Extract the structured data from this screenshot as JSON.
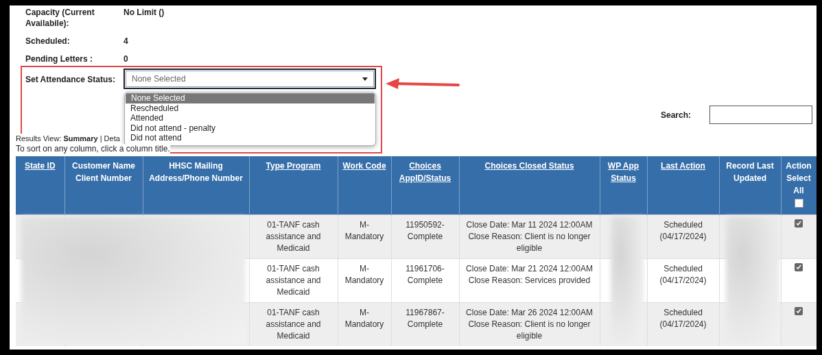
{
  "info": [
    {
      "label": "Capacity (Current Availabile):",
      "value": "No Limit ()"
    },
    {
      "label": "Scheduled:",
      "value": "4"
    },
    {
      "label": "Pending Letters :",
      "value": "0"
    }
  ],
  "attendance": {
    "label": "Set Attendance Status:",
    "value": "None Selected",
    "expanded": true,
    "options": [
      {
        "label": "None Selected",
        "selected": true
      },
      {
        "label": "Rescheduled",
        "selected": false
      },
      {
        "label": "Attended",
        "selected": false
      },
      {
        "label": "Did not attend - penalty",
        "selected": false
      },
      {
        "label": "Did not attend",
        "selected": false
      }
    ]
  },
  "search": {
    "label": "Search:"
  },
  "results_view": "Results View: **Summary** | Deta",
  "sort_hint": "To sort on any column, click a column title.",
  "table": {
    "columns": [
      {
        "label": "State ID",
        "sortable": true
      },
      {
        "label": "Customer Name Client Number",
        "sortable": false
      },
      {
        "label": "HHSC Mailing Address/Phone Number",
        "sortable": false
      },
      {
        "label": "Type Program",
        "sortable": true
      },
      {
        "label": "Work Code",
        "sortable": true
      },
      {
        "label": "Choices AppID/Status",
        "sortable": true
      },
      {
        "label": "Choices Closed Status",
        "sortable": true
      },
      {
        "label": "WP App Status",
        "sortable": true
      },
      {
        "label": "Last Action",
        "sortable": true
      },
      {
        "label": "Record Last Updated",
        "sortable": false
      },
      {
        "label": "Action Select All",
        "sortable": false
      }
    ],
    "select_all": {
      "checked": false
    },
    "rows": [
      {
        "type_program": "01-TANF cash assistance and Medicaid",
        "work_code": "M-Mandatory",
        "choices_app": "11950592-Complete",
        "close_date": "Close Date: Mar 11 2024 12:00AM",
        "close_reason": "Close Reason: Client is no longer eligible",
        "last_action": "Scheduled (04/17/2024)",
        "checked": true
      },
      {
        "type_program": "01-TANF cash assistance and Medicaid",
        "work_code": "M-Mandatory",
        "choices_app": "11961706-Complete",
        "close_date": "Close Date: Mar 21 2024 12:00AM",
        "close_reason": "Close Reason: Services provided",
        "last_action": "Scheduled (04/17/2024)",
        "checked": true
      },
      {
        "type_program": "01-TANF cash assistance and Medicaid",
        "work_code": "M-Mandatory",
        "choices_app": "11967867-Complete",
        "close_date": "Close Date: Mar 26 2024 12:00AM",
        "close_reason": "Close Reason: Client is no longer eligible",
        "last_action": "Scheduled (04/17/2024)",
        "checked": true
      }
    ]
  }
}
